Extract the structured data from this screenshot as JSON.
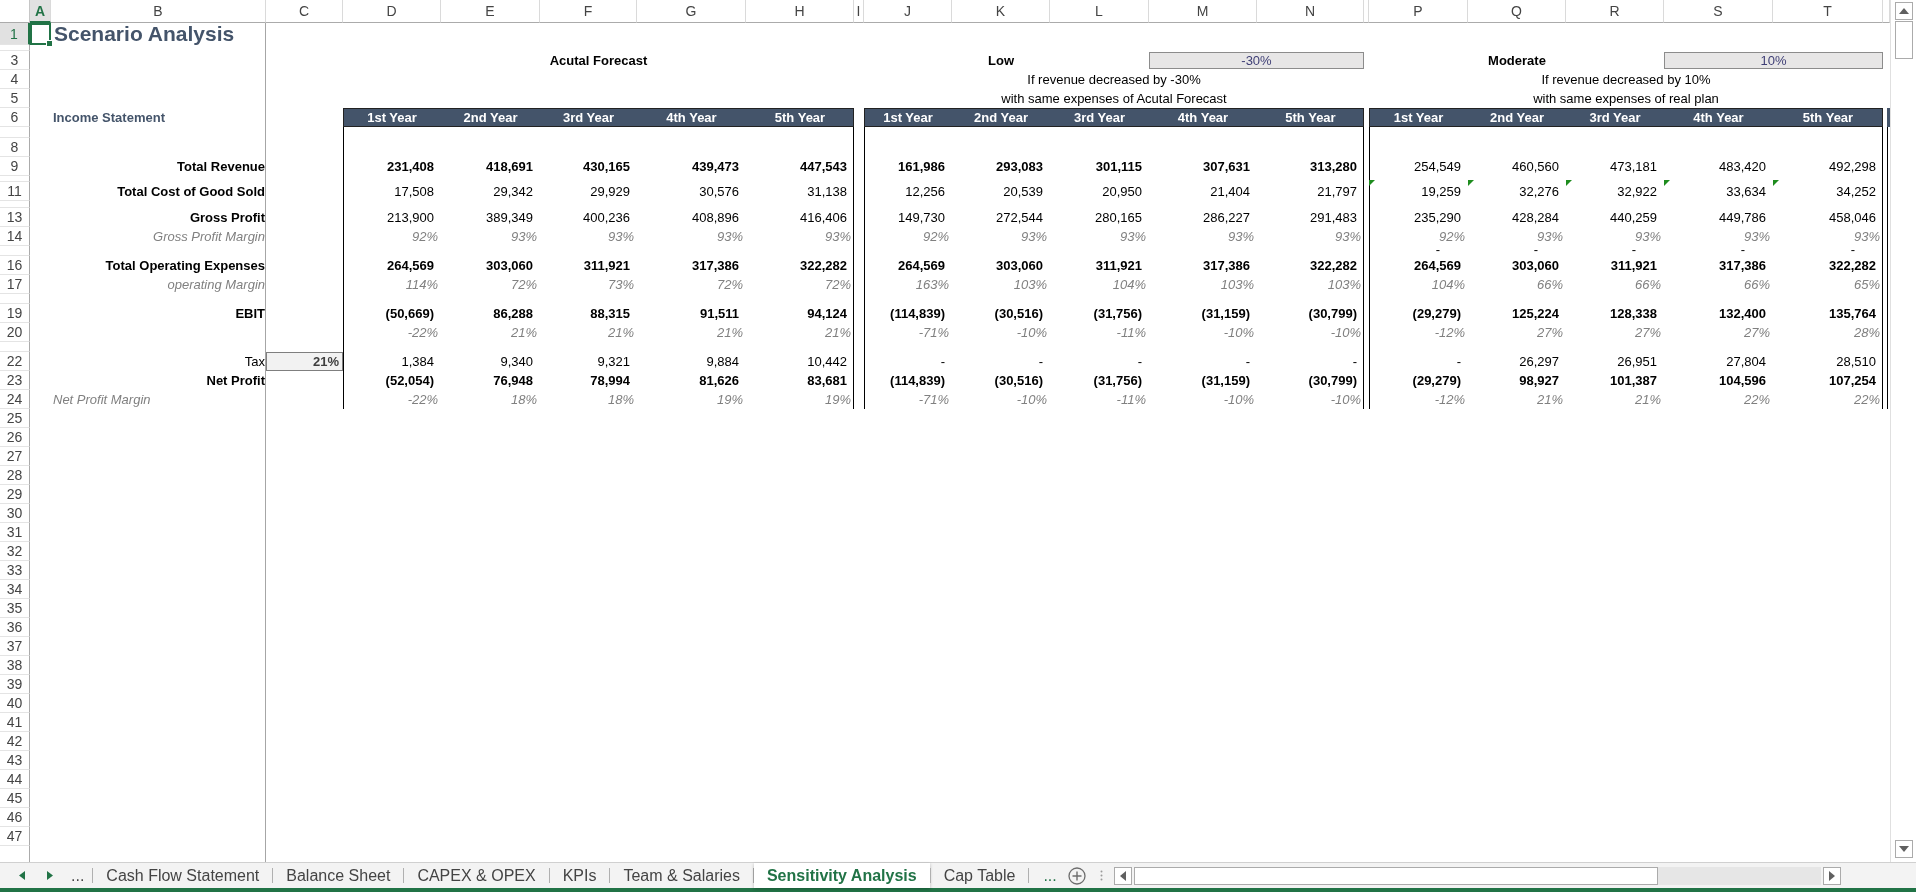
{
  "column_headers": [
    {
      "label": "A",
      "selected": true
    },
    {
      "label": "B",
      "selected": false
    },
    {
      "label": "C",
      "selected": false
    },
    {
      "label": "D",
      "selected": false
    },
    {
      "label": "E",
      "selected": false
    },
    {
      "label": "F",
      "selected": false
    },
    {
      "label": "G",
      "selected": false
    },
    {
      "label": "H",
      "selected": false
    },
    {
      "label": "I",
      "selected": false
    },
    {
      "label": "J",
      "selected": false
    },
    {
      "label": "K",
      "selected": false
    },
    {
      "label": "L",
      "selected": false
    },
    {
      "label": "M",
      "selected": false
    },
    {
      "label": "N",
      "selected": false
    },
    {
      "label": "P",
      "selected": false
    },
    {
      "label": "Q",
      "selected": false
    },
    {
      "label": "R",
      "selected": false
    },
    {
      "label": "S",
      "selected": false
    },
    {
      "label": "T",
      "selected": false
    }
  ],
  "row_headers": [
    {
      "label": "1",
      "selected": true
    },
    {
      "label": "3",
      "selected": false
    },
    {
      "label": "4",
      "selected": false
    },
    {
      "label": "5",
      "selected": false
    },
    {
      "label": "6",
      "selected": false
    },
    {
      "label": "8",
      "selected": false
    },
    {
      "label": "9",
      "selected": false
    },
    {
      "label": "11",
      "selected": false
    },
    {
      "label": "13",
      "selected": false
    },
    {
      "label": "14",
      "selected": false
    },
    {
      "label": "16",
      "selected": false
    },
    {
      "label": "17",
      "selected": false
    },
    {
      "label": "19",
      "selected": false
    },
    {
      "label": "20",
      "selected": false
    },
    {
      "label": "22",
      "selected": false
    },
    {
      "label": "23",
      "selected": false
    },
    {
      "label": "24",
      "selected": false
    },
    {
      "label": "25",
      "selected": false
    },
    {
      "label": "26",
      "selected": false
    },
    {
      "label": "27",
      "selected": false
    },
    {
      "label": "28",
      "selected": false
    },
    {
      "label": "29",
      "selected": false
    },
    {
      "label": "30",
      "selected": false
    },
    {
      "label": "31",
      "selected": false
    },
    {
      "label": "32",
      "selected": false
    },
    {
      "label": "33",
      "selected": false
    },
    {
      "label": "34",
      "selected": false
    },
    {
      "label": "35",
      "selected": false
    },
    {
      "label": "36",
      "selected": false
    },
    {
      "label": "37",
      "selected": false
    },
    {
      "label": "38",
      "selected": false
    },
    {
      "label": "39",
      "selected": false
    },
    {
      "label": "40",
      "selected": false
    },
    {
      "label": "41",
      "selected": false
    },
    {
      "label": "42",
      "selected": false
    },
    {
      "label": "43",
      "selected": false
    },
    {
      "label": "44",
      "selected": false
    },
    {
      "label": "45",
      "selected": false
    },
    {
      "label": "46",
      "selected": false
    },
    {
      "label": "47",
      "selected": false
    }
  ],
  "title": "Scenario Analysis",
  "section_label": "Income Statement",
  "line_items": [
    {
      "label": "Total Revenue",
      "kind": "bold"
    },
    {
      "label": "Total Cost of Good Sold",
      "kind": "bold"
    },
    {
      "label": "Gross Profit",
      "kind": "bold"
    },
    {
      "label": "Gross Profit Margin",
      "kind": "italic"
    },
    {
      "label": "Total Operating Expenses",
      "kind": "bold"
    },
    {
      "label": "operating Margin",
      "kind": "italic"
    },
    {
      "label": "EBIT",
      "kind": "bold"
    },
    {
      "label": "Tax",
      "kind": "plain",
      "input": "21%"
    },
    {
      "label": "Net Profit",
      "kind": "bold"
    },
    {
      "label": "Net Profit Margin",
      "kind": "note"
    }
  ],
  "scenarios": [
    {
      "title": "Acutal Forecast",
      "year_headers": [
        "1st Year",
        "2nd Year",
        "3rd Year",
        "4th Year",
        "5th Year"
      ],
      "rows": [
        {
          "kind": "bold",
          "values": [
            "231,408",
            "418,691",
            "430,165",
            "439,473",
            "447,543"
          ]
        },
        {
          "kind": "plain",
          "values": [
            "17,508",
            "29,342",
            "29,929",
            "30,576",
            "31,138"
          ]
        },
        {
          "kind": "plain",
          "values": [
            "213,900",
            "389,349",
            "400,236",
            "408,896",
            "416,406"
          ]
        },
        {
          "kind": "italic",
          "values": [
            "92%",
            "93%",
            "93%",
            "93%",
            "93%"
          ]
        },
        {
          "kind": "bold",
          "values": [
            "264,569",
            "303,060",
            "311,921",
            "317,386",
            "322,282"
          ]
        },
        {
          "kind": "italic",
          "values": [
            "114%",
            "72%",
            "73%",
            "72%",
            "72%"
          ]
        },
        {
          "kind": "bold",
          "values": [
            "(50,669)",
            "86,288",
            "88,315",
            "91,511",
            "94,124"
          ]
        },
        {
          "kind": "italic",
          "values": [
            "-22%",
            "21%",
            "21%",
            "21%",
            "21%"
          ]
        },
        {
          "kind": "plain",
          "values": [
            "1,384",
            "9,340",
            "9,321",
            "9,884",
            "10,442"
          ]
        },
        {
          "kind": "bold",
          "values": [
            "(52,054)",
            "76,948",
            "78,994",
            "81,626",
            "83,681"
          ]
        },
        {
          "kind": "italic",
          "values": [
            "-22%",
            "18%",
            "18%",
            "19%",
            "19%"
          ]
        }
      ]
    },
    {
      "title": "Low",
      "rate": "-30%",
      "description": [
        "If revenue decreased by -30%",
        "with same expenses of Acutal Forecast"
      ],
      "year_headers": [
        "1st Year",
        "2nd Year",
        "3rd Year",
        "4th Year",
        "5th Year"
      ],
      "rows": [
        {
          "kind": "bold",
          "values": [
            "161,986",
            "293,083",
            "301,115",
            "307,631",
            "313,280"
          ]
        },
        {
          "kind": "plain",
          "values": [
            "12,256",
            "20,539",
            "20,950",
            "21,404",
            "21,797"
          ]
        },
        {
          "kind": "plain",
          "values": [
            "149,730",
            "272,544",
            "280,165",
            "286,227",
            "291,483"
          ]
        },
        {
          "kind": "italic",
          "values": [
            "92%",
            "93%",
            "93%",
            "93%",
            "93%"
          ]
        },
        {
          "kind": "bold",
          "values": [
            "264,569",
            "303,060",
            "311,921",
            "317,386",
            "322,282"
          ]
        },
        {
          "kind": "italic",
          "values": [
            "163%",
            "103%",
            "104%",
            "103%",
            "103%"
          ]
        },
        {
          "kind": "bold",
          "values": [
            "(114,839)",
            "(30,516)",
            "(31,756)",
            "(31,159)",
            "(30,799)"
          ]
        },
        {
          "kind": "italic",
          "values": [
            "-71%",
            "-10%",
            "-11%",
            "-10%",
            "-10%"
          ]
        },
        {
          "kind": "plain",
          "values": [
            "-",
            "-",
            "-",
            "-",
            "-"
          ]
        },
        {
          "kind": "bold",
          "values": [
            "(114,839)",
            "(30,516)",
            "(31,756)",
            "(31,159)",
            "(30,799)"
          ]
        },
        {
          "kind": "italic",
          "values": [
            "-71%",
            "-10%",
            "-11%",
            "-10%",
            "-10%"
          ]
        }
      ]
    },
    {
      "title": "Moderate",
      "rate": "10%",
      "description": [
        "If revenue decreased by 10%",
        "with same expenses of real plan"
      ],
      "year_headers": [
        "1st Year",
        "2nd Year",
        "3rd Year",
        "4th Year",
        "5th Year"
      ],
      "separator": [
        "-",
        "-",
        "-",
        "-",
        "-"
      ],
      "rows": [
        {
          "kind": "plain",
          "values": [
            "254,549",
            "460,560",
            "473,181",
            "483,420",
            "492,298"
          ]
        },
        {
          "kind": "plain",
          "flagged": true,
          "values": [
            "19,259",
            "32,276",
            "32,922",
            "33,634",
            "34,252"
          ]
        },
        {
          "kind": "plain",
          "values": [
            "235,290",
            "428,284",
            "440,259",
            "449,786",
            "458,046"
          ]
        },
        {
          "kind": "italic",
          "values": [
            "92%",
            "93%",
            "93%",
            "93%",
            "93%"
          ]
        },
        {
          "kind": "bold",
          "values": [
            "264,569",
            "303,060",
            "311,921",
            "317,386",
            "322,282"
          ]
        },
        {
          "kind": "italic",
          "values": [
            "104%",
            "66%",
            "66%",
            "66%",
            "65%"
          ]
        },
        {
          "kind": "bold",
          "values": [
            "(29,279)",
            "125,224",
            "128,338",
            "132,400",
            "135,764"
          ]
        },
        {
          "kind": "italic",
          "values": [
            "-12%",
            "27%",
            "27%",
            "27%",
            "28%"
          ]
        },
        {
          "kind": "plain",
          "values": [
            "-",
            "26,297",
            "26,951",
            "27,804",
            "28,510"
          ]
        },
        {
          "kind": "bold",
          "values": [
            "(29,279)",
            "98,927",
            "101,387",
            "104,596",
            "107,254"
          ]
        },
        {
          "kind": "italic",
          "values": [
            "-12%",
            "21%",
            "21%",
            "22%",
            "22%"
          ]
        }
      ]
    }
  ],
  "sheet_tabs": {
    "more_left": "...",
    "more_right": "...",
    "tabs": [
      {
        "label": "Cash Flow Statement",
        "selected": false
      },
      {
        "label": "Balance Sheet",
        "selected": false
      },
      {
        "label": "CAPEX & OPEX",
        "selected": false
      },
      {
        "label": "KPIs",
        "selected": false
      },
      {
        "label": "Team & Salaries",
        "selected": false
      },
      {
        "label": "Sensitivity Analysis",
        "selected": true
      },
      {
        "label": "Cap Table",
        "selected": false
      }
    ]
  }
}
